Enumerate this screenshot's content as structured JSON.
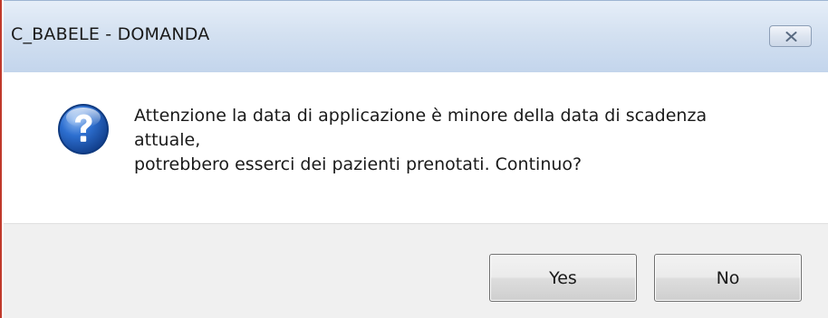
{
  "window": {
    "title": "C_BABELE - DOMANDA"
  },
  "message": {
    "line1": "Attenzione la data di applicazione è minore della data di scadenza",
    "line2": "attuale,",
    "line3": "potrebbero esserci dei pazienti prenotati. Continuo?"
  },
  "buttons": {
    "yes_label": "Yes",
    "no_label": "No"
  },
  "icons": {
    "message_icon": "question-icon",
    "close_icon": "close-icon"
  },
  "colors": {
    "titlebar": "#d4e1f1",
    "question_icon": "#1f5fb8",
    "footer": "#f0f0f0"
  }
}
